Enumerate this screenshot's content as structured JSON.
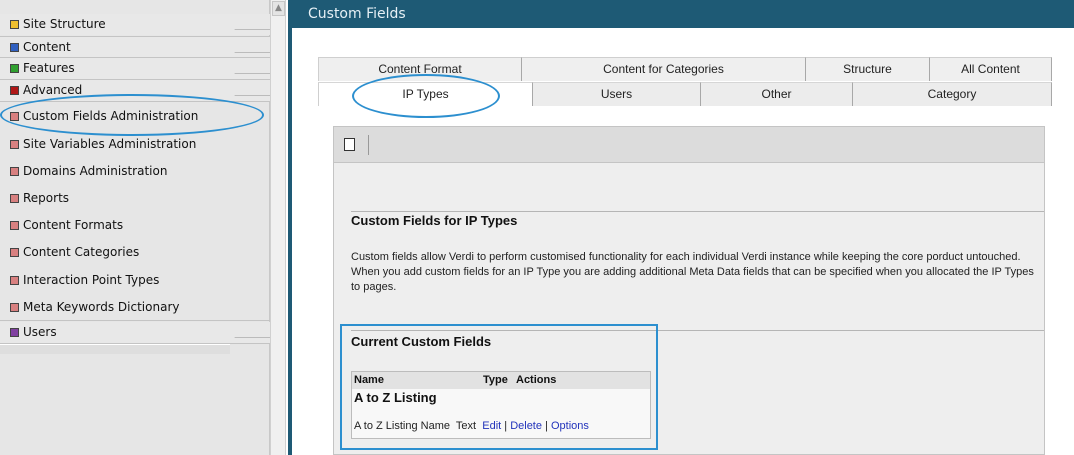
{
  "sidebar": {
    "items": [
      {
        "label": "Site Structure",
        "color": "#f0c030"
      },
      {
        "label": "Content",
        "color": "#3060c0"
      },
      {
        "label": "Features",
        "color": "#30a030"
      },
      {
        "label": "Advanced",
        "color": "#b01818"
      },
      {
        "label": "Custom Fields Administration",
        "color": "#d88080"
      },
      {
        "label": "Site Variables Administration",
        "color": "#d88080"
      },
      {
        "label": "Domains Administration",
        "color": "#d88080"
      },
      {
        "label": "Reports",
        "color": "#d88080"
      },
      {
        "label": "Content Formats",
        "color": "#d88080"
      },
      {
        "label": "Content Categories",
        "color": "#d88080"
      },
      {
        "label": "Interaction Point Types",
        "color": "#d88080"
      },
      {
        "label": "Meta Keywords Dictionary",
        "color": "#d88080"
      },
      {
        "label": "Users",
        "color": "#8040a0"
      }
    ]
  },
  "main": {
    "title": "Custom Fields",
    "tabs_back": [
      "Content Format",
      "Content for Categories",
      "Structure",
      "All Content"
    ],
    "tabs_front": [
      "IP Types",
      "Users",
      "Other",
      "Category"
    ],
    "active_tab": "IP Types",
    "toolbar": {
      "new_icon": "new-document-icon"
    },
    "section_title": "Custom Fields for IP Types",
    "description": "Custom fields allow Verdi to perform customised functionality for each individual Verdi instance while keeping the core porduct untouched. When you add custom fields for an IP Type you are adding additional Meta Data fields that can be specified when you allocated the IP Types to pages.",
    "current_title": "Current Custom Fields",
    "table": {
      "headers": [
        "Name",
        "Type",
        "Actions"
      ],
      "group": "A to Z Listing",
      "row": {
        "name": "A to Z Listing Name",
        "type": "Text",
        "actions": [
          "Edit",
          "Delete",
          "Options"
        ],
        "separator": "|"
      }
    }
  },
  "colors": {
    "titlebar": "#1e5a75",
    "annotation": "#2c8fcf",
    "link": "#2233bb"
  }
}
